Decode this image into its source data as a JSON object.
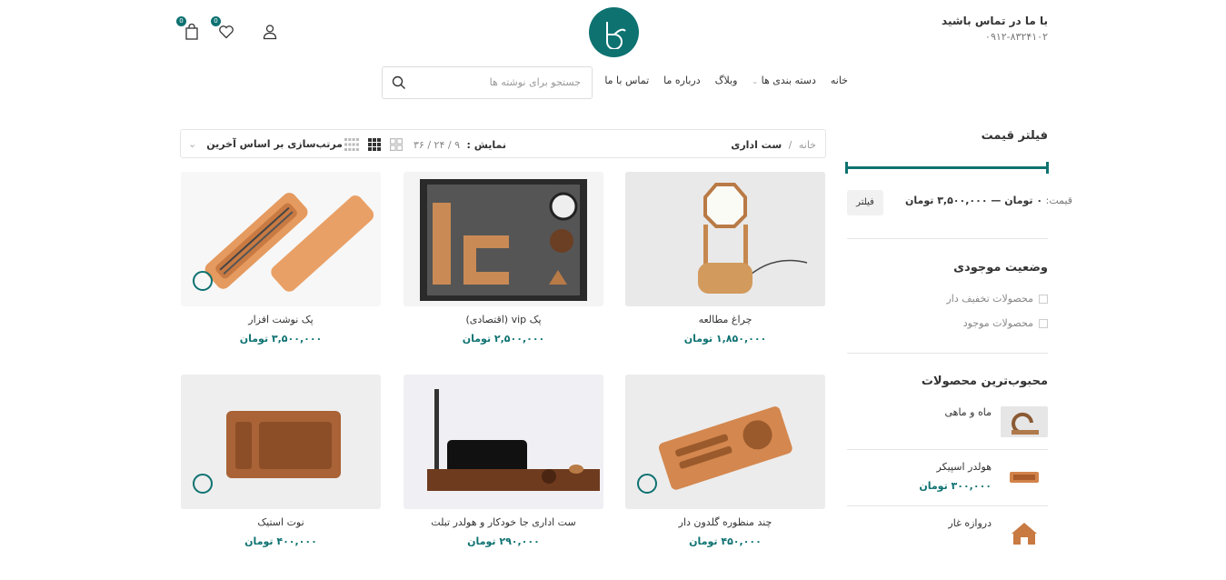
{
  "header": {
    "contact_title": "با ما در تماس باشید",
    "phone": "۰۹۱۲-۸۳۲۴۱۰۲",
    "cart_count": "0",
    "wishlist_count": "0"
  },
  "nav": {
    "items": [
      "خانه",
      "دسته بندی ها",
      "وبلاگ",
      "درباره ما",
      "تماس با ما"
    ],
    "search_placeholder": "جستجو برای نوشته ها"
  },
  "toolbar": {
    "breadcrumb_home": "خانه",
    "breadcrumb_sep": "/",
    "breadcrumb_current": "ست اداری",
    "show_label": "نمایش :",
    "show_options": "۹ / ۲۴ / ۳۶",
    "sort_label": "مرتب‌سازی بر اساس آخرین"
  },
  "products": [
    {
      "name": "چراغ مطالعه",
      "price": "۱,۸۵۰,۰۰۰ تومان"
    },
    {
      "name": "پک vip (اقتصادی)",
      "price": "۲,۵۰۰,۰۰۰ تومان"
    },
    {
      "name": "پک نوشت افزار",
      "price": "۳,۵۰۰,۰۰۰ تومان"
    },
    {
      "name": "چند منظوره گلدون دار",
      "price": "۴۵۰,۰۰۰ تومان"
    },
    {
      "name": "ست اداری جا خودکار و هولدر تبلت",
      "price": "۲۹۰,۰۰۰ تومان"
    },
    {
      "name": "نوت استیک",
      "price": "۴۰۰,۰۰۰ تومان"
    }
  ],
  "sidebar": {
    "price_filter_title": "فیلتر قیمت",
    "price_label": "قیمت:",
    "price_range": "۰ تومان — ۳,۵۰۰,۰۰۰ تومان",
    "filter_button": "فیلتر",
    "stock_title": "وضعیت موجودی",
    "stock_options": [
      "محصولات تخفیف دار",
      "محصولات موجود"
    ],
    "popular_title": "محبوب‌ترین محصولات",
    "popular": [
      {
        "name": "ماه و ماهی",
        "price": ""
      },
      {
        "name": "هولدر اسپیکر",
        "price": "۳۰۰,۰۰۰ تومان"
      },
      {
        "name": "دروازه غار",
        "price": ""
      }
    ]
  },
  "colors": {
    "accent": "#0e7271"
  }
}
